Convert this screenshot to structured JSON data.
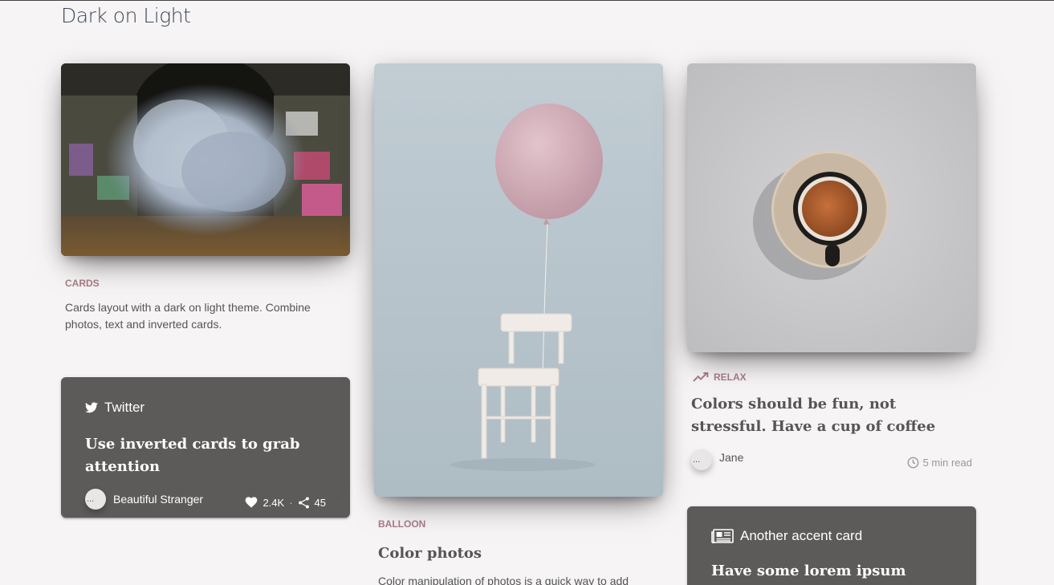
{
  "page": {
    "title": "Dark on Light"
  },
  "card1": {
    "category": "CARDS",
    "text": "Cards layout with a dark on light theme. Combine photos, text and inverted cards."
  },
  "twitter_card": {
    "header": "Twitter",
    "title": "Use inverted cards to grab attention",
    "avatar_alt": "...",
    "author": "Beautiful Stranger",
    "likes": "2.4K",
    "separator": "·",
    "shares": "45",
    "bg": "#5d5b59"
  },
  "balloon_card": {
    "category": "BALLOON",
    "title": "Color photos",
    "text": "Color manipulation of photos is a quick way to add"
  },
  "relax_card": {
    "category": "RELAX",
    "title": "Colors should be fun, not stressful. Have a cup of coffee",
    "avatar_alt": "...",
    "author": "Jane",
    "read_time": "5 min read"
  },
  "accent_card": {
    "header": "Another accent card",
    "title": "Have some lorem ipsum"
  },
  "colors": {
    "accent": "#a87d88",
    "background": "#f6f4f4",
    "dark_card": "#5d5b59"
  },
  "icons": [
    "twitter-icon",
    "heart-icon",
    "share-icon",
    "trending-up-icon",
    "clock-icon",
    "newspaper-icon"
  ]
}
